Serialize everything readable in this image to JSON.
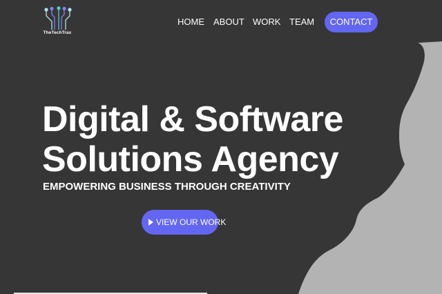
{
  "brand": {
    "name": "TheTechTrax",
    "logo_icon": "circuit-nodes-icon",
    "colors": {
      "background": "#363636",
      "accent": "#6366f1",
      "shape": "#b3b3b3",
      "node_light": "#aee6ec",
      "node_teal": "#4fd1c5",
      "node_purple": "#8b7cf6"
    }
  },
  "nav": {
    "items": [
      {
        "label": "HOME"
      },
      {
        "label": "ABOUT"
      },
      {
        "label": "WORK"
      },
      {
        "label": "TEAM"
      }
    ],
    "contact_label": "CONTACT"
  },
  "hero": {
    "title_line1": "Digital & Software",
    "title_line2": "Solutions Agency",
    "subtitle": "EMPOWERING BUSINESS THROUGH CREATIVITY",
    "cta_label": "VIEW OUR WORK",
    "cta_icon": "play-icon"
  }
}
